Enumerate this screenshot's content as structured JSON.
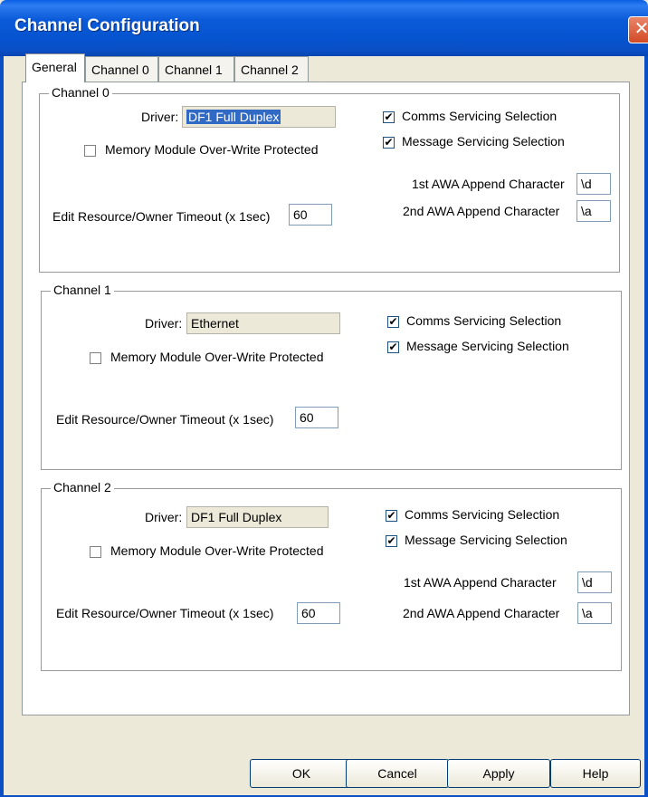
{
  "window": {
    "title": "Channel Configuration",
    "close_glyph": "✕"
  },
  "tabs": [
    "General",
    "Channel 0",
    "Channel 1",
    "Channel 2"
  ],
  "channel0": {
    "title": "Channel 0",
    "driver_label": "Driver:",
    "driver_value": "DF1 Full Duplex",
    "memory_protect_label": "Memory Module Over-Write Protected",
    "memory_protect_checked": false,
    "comms_label": "Comms Servicing Selection",
    "comms_checked": true,
    "message_label": "Message Servicing Selection",
    "message_checked": true,
    "awa1_label": "1st AWA Append Character",
    "awa1_value": "\\d",
    "awa2_label": "2nd AWA Append Character",
    "awa2_value": "\\a",
    "timeout_label": "Edit Resource/Owner Timeout (x 1sec)",
    "timeout_value": "60"
  },
  "channel1": {
    "title": "Channel 1",
    "driver_label": "Driver:",
    "driver_value": "Ethernet",
    "memory_protect_label": "Memory Module Over-Write Protected",
    "memory_protect_checked": false,
    "comms_label": "Comms Servicing Selection",
    "comms_checked": true,
    "message_label": "Message Servicing Selection",
    "message_checked": true,
    "timeout_label": "Edit Resource/Owner Timeout (x 1sec)",
    "timeout_value": "60"
  },
  "channel2": {
    "title": "Channel 2",
    "driver_label": "Driver:",
    "driver_value": "DF1 Full Duplex",
    "memory_protect_label": "Memory Module Over-Write Protected",
    "memory_protect_checked": false,
    "comms_label": "Comms Servicing Selection",
    "comms_checked": true,
    "message_label": "Message Servicing Selection",
    "message_checked": true,
    "awa1_label": "1st AWA Append Character",
    "awa1_value": "\\d",
    "awa2_label": "2nd AWA Append Character",
    "awa2_value": "\\a",
    "timeout_label": "Edit Resource/Owner Timeout (x 1sec)",
    "timeout_value": "60"
  },
  "check_glyph": "✔",
  "buttons": {
    "ok": "OK",
    "cancel": "Cancel",
    "apply": "Apply",
    "help": "Help"
  }
}
